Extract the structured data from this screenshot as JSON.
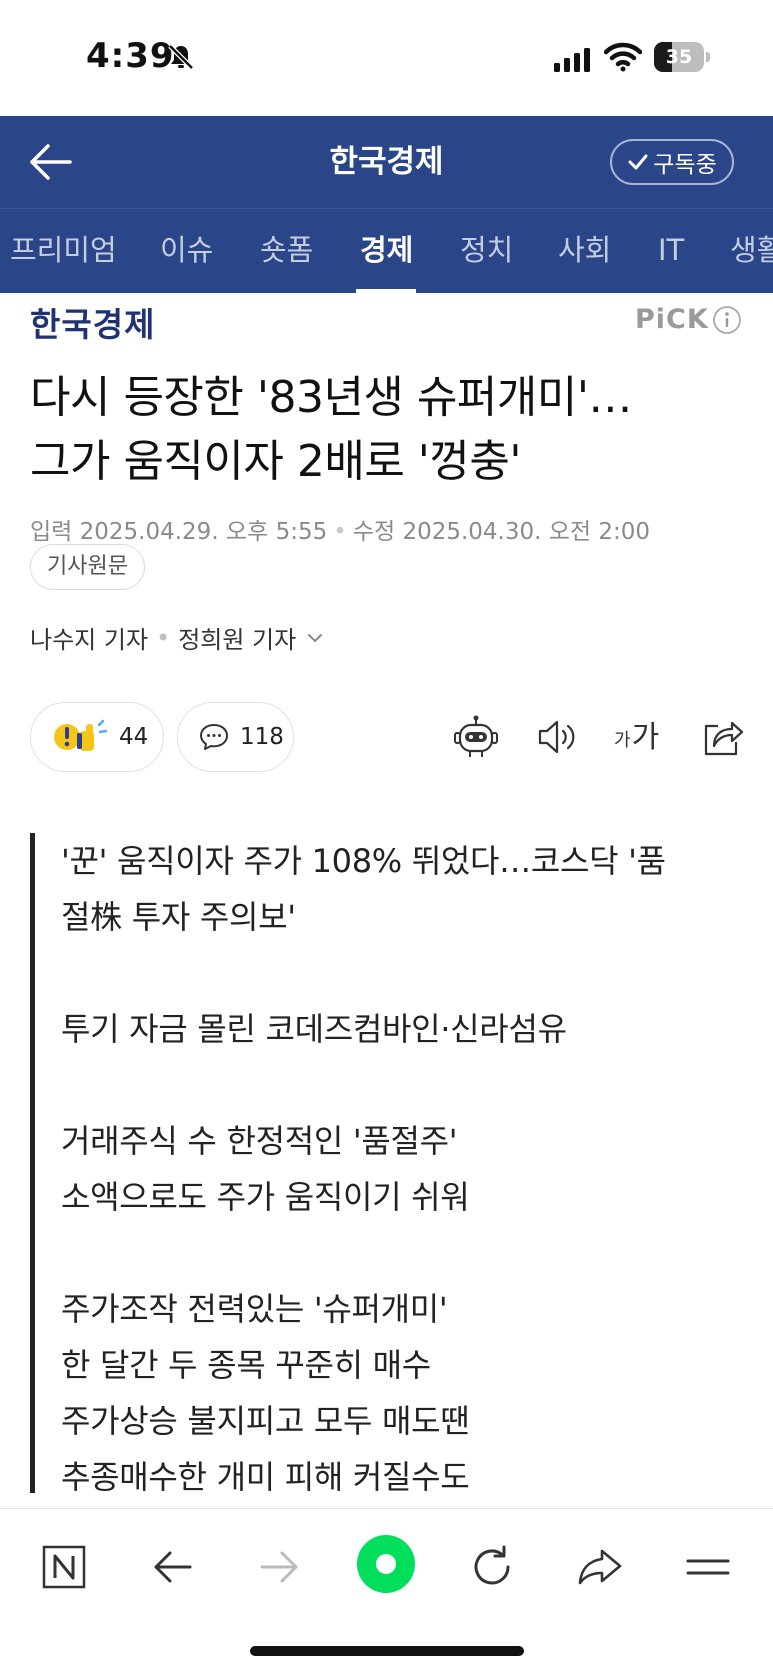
{
  "status_bar": {
    "time": "4:39",
    "battery": "35",
    "battery_level": 0.35
  },
  "header": {
    "title": "한국경제",
    "subscribe_label": "구독중"
  },
  "tabs": [
    "프리미엄",
    "이슈",
    "숏폼",
    "경제",
    "정치",
    "사회",
    "IT",
    "생활"
  ],
  "active_tab": "경제",
  "article": {
    "press_logo": "한국경제",
    "pick_label": "PiCK",
    "headline_line1": "다시 등장한 '83년생 슈퍼개미'…",
    "headline_line2": "그가 움직이자 2배로 '껑충'",
    "input_date": "입력 2025.04.29. 오후 5:55",
    "modified_date": "수정 2025.04.30. 오전 2:00",
    "source_button": "기사원문",
    "reporter1": "나수지 기자",
    "reporter2": "정희원 기자",
    "reaction_count": "44",
    "comment_count": "118",
    "font_size_small": "가",
    "font_size_big": "가",
    "summary": [
      "'꾼' 움직이자 주가 108% 뛰었다…코스닥 '품",
      "절株 투자 주의보'",
      "",
      "투기 자금 몰린 코데즈컴바인·신라섬유",
      "",
      "거래주식 수 한정적인 '품절주'",
      "소액으로도 주가 움직이기 쉬워",
      "",
      "주가조작 전력있는 '슈퍼개미'",
      "한 달간 두 종목 꾸준히 매수",
      "주가상승 불지피고 모두 매도땐",
      "추종매수한 개미 피해 커질수도"
    ]
  },
  "colors": {
    "header_bg": "#2b4589",
    "press_logo": "#1f3373",
    "browser_accent": "#00de5a"
  }
}
